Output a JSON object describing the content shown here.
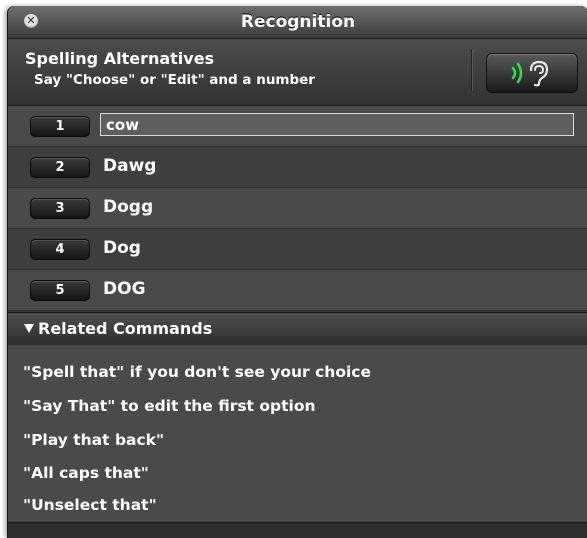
{
  "window": {
    "title": "Recognition",
    "close_glyph": "✕"
  },
  "header": {
    "title": "Spelling Alternatives",
    "subtitle": "Say \"Choose\" or \"Edit\" and a number",
    "mic_icon": "ear-icon",
    "accent_color": "#2ee04a"
  },
  "alternatives": [
    {
      "number": "1",
      "text": "cow",
      "editing": true
    },
    {
      "number": "2",
      "text": "Dawg"
    },
    {
      "number": "3",
      "text": "Dogg"
    },
    {
      "number": "4",
      "text": "Dog"
    },
    {
      "number": "5",
      "text": "DOG"
    }
  ],
  "related": {
    "title": "Related Commands",
    "commands": [
      "\"Spell that\" if you don't see your choice",
      "\"Say That\" to edit the first option",
      "\"Play that back\"",
      "\"All caps that\"",
      "\"Unselect that\""
    ]
  }
}
